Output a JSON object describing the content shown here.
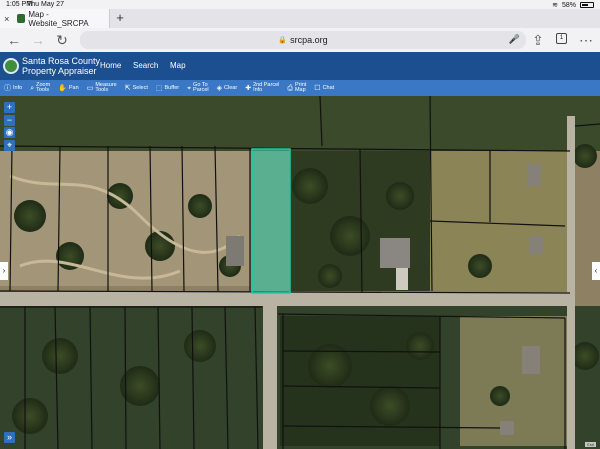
{
  "status": {
    "time": "1:05 PM",
    "date": "Thu May 27",
    "battery": "58%"
  },
  "browser": {
    "tab_title": "Map - Website_SRCPA",
    "url": "srcpa.org",
    "tab_count": "1"
  },
  "site": {
    "brand_line1": "Santa Rosa County",
    "brand_line2": "Property Appraiser",
    "nav": [
      "Home",
      "Search",
      "Map"
    ]
  },
  "tools": [
    {
      "icon": "info-icon",
      "label": "Info"
    },
    {
      "icon": "zoom-icon",
      "label": "Zoom\nTools"
    },
    {
      "icon": "pan-icon",
      "label": "Pan"
    },
    {
      "icon": "measure-icon",
      "label": "Measure\nTools"
    },
    {
      "icon": "select-icon",
      "label": "Select"
    },
    {
      "icon": "buffer-icon",
      "label": "Buffer"
    },
    {
      "icon": "goto-icon",
      "label": "Go To\nParcel"
    },
    {
      "icon": "clear-icon",
      "label": "Clear"
    },
    {
      "icon": "parcel-info-icon",
      "label": "2nd Parcel\nInfo"
    },
    {
      "icon": "print-icon",
      "label": "Print\nMap"
    },
    {
      "icon": "chat-icon",
      "label": "Chat"
    }
  ],
  "colors": {
    "header": "#1b4f8f",
    "toolbar": "#3a77c4",
    "selection": "#2fd6b6"
  }
}
